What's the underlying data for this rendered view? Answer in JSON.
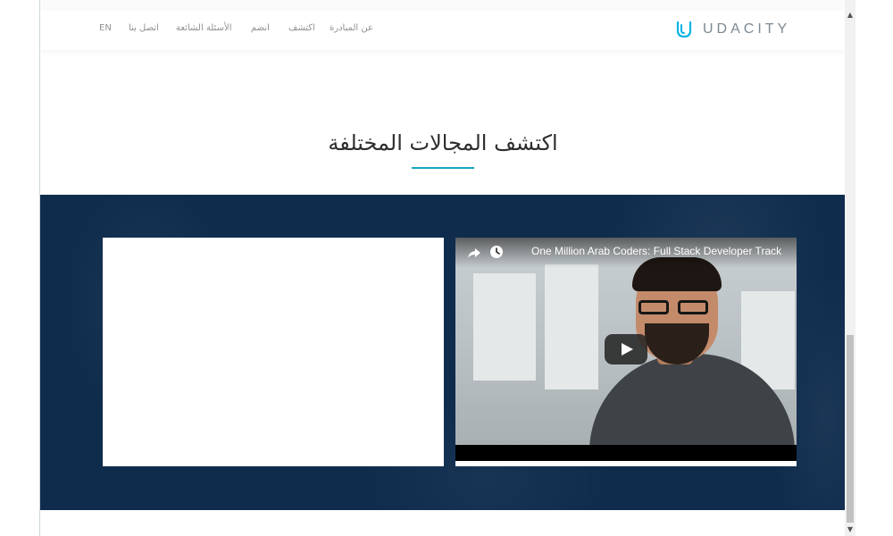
{
  "header": {
    "logo_text": "UDACITY",
    "nav_links": [
      "عن المبادرة",
      "اكتشف",
      "انضم",
      "الأسئلة الشائعة",
      "اتصل بنا",
      "EN"
    ]
  },
  "section": {
    "title": "اكتشف المجالات المختلفة"
  },
  "video": {
    "title": "One Million Arab Coders: Full Stack Developer Track",
    "share_icon": "share-icon",
    "watch_later_icon": "clock-icon",
    "play_icon": "play-icon"
  },
  "colors": {
    "accent": "#15a6c0",
    "band": "#0f2c4d"
  }
}
